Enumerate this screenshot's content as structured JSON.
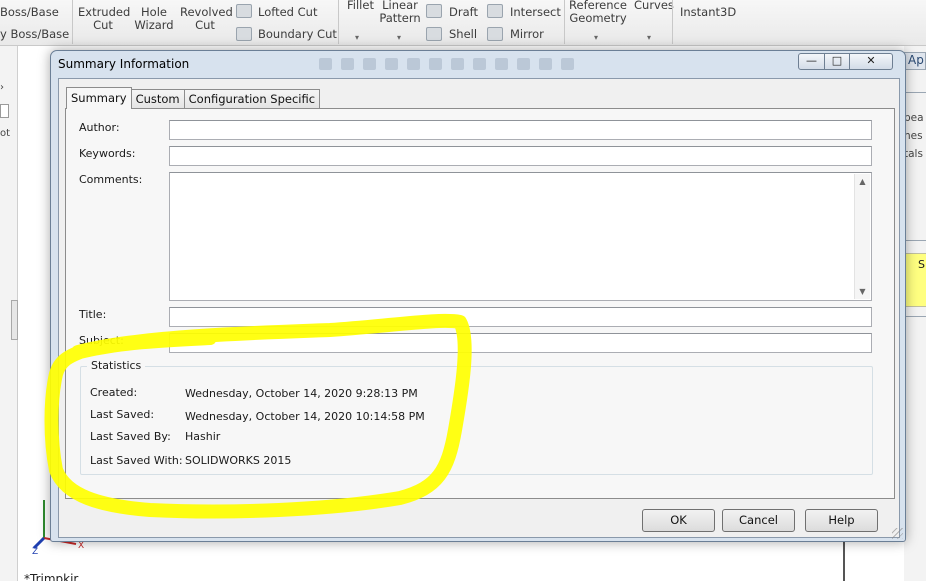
{
  "ribbon": {
    "items": [
      {
        "id": "boss_base",
        "label": "Boss/Base"
      },
      {
        "id": "swept_boss",
        "label": "y Boss/Base"
      },
      {
        "id": "extruded_cut",
        "label": "Extruded Cut"
      },
      {
        "id": "hole_wizard",
        "label": "Hole Wizard"
      },
      {
        "id": "revolved_cut",
        "label": "Revolved Cut"
      },
      {
        "id": "lofted_cut",
        "label": "Lofted Cut"
      },
      {
        "id": "boundary_cut",
        "label": "Boundary Cut"
      },
      {
        "id": "fillet",
        "label": "Fillet"
      },
      {
        "id": "linear_pattern",
        "label": "Linear Pattern"
      },
      {
        "id": "draft",
        "label": "Draft"
      },
      {
        "id": "shell",
        "label": "Shell"
      },
      {
        "id": "intersect",
        "label": "Intersect"
      },
      {
        "id": "mirror",
        "label": "Mirror"
      },
      {
        "id": "reference_geometry",
        "label": "Reference Geometry"
      },
      {
        "id": "curves",
        "label": "Curves"
      },
      {
        "id": "instant3d",
        "label": "Instant3D"
      }
    ]
  },
  "background": {
    "right_panel_tab": "Ap",
    "right_panel_lines": [
      "bea",
      "nes",
      "tals"
    ],
    "right_panel_yellow": "S",
    "left_panel_text": "ot",
    "bottom_text": "*Trimpkir"
  },
  "dialog": {
    "title": "Summary Information",
    "tabs": [
      {
        "label": "Summary",
        "active": true
      },
      {
        "label": "Custom",
        "active": false
      },
      {
        "label": "Configuration Specific",
        "active": false
      }
    ],
    "fields": {
      "author": {
        "label": "Author:",
        "value": ""
      },
      "keywords": {
        "label": "Keywords:",
        "value": ""
      },
      "comments": {
        "label": "Comments:",
        "value": ""
      },
      "title": {
        "label": "Title:",
        "value": ""
      },
      "subject": {
        "label": "Subject:",
        "value": ""
      }
    },
    "statistics": {
      "legend": "Statistics",
      "rows": [
        {
          "label": "Created:",
          "value": "Wednesday, October 14, 2020 9:28:13 PM"
        },
        {
          "label": "Last Saved:",
          "value": "Wednesday, October 14, 2020 10:14:58 PM"
        },
        {
          "label": "Last Saved By:",
          "value": "Hashir"
        },
        {
          "label": "Last Saved With:",
          "value": "SOLIDWORKS 2015"
        }
      ]
    },
    "buttons": {
      "ok": "OK",
      "cancel": "Cancel",
      "help": "Help"
    },
    "window_controls": {
      "minimize": "—",
      "maximize": "□",
      "close": "✕"
    }
  },
  "annotation": {
    "color": "#ffff00",
    "kind": "freehand-circle"
  },
  "colors": {
    "dialog_frame": "#d7e2ee",
    "highlight": "#ffff00",
    "right_yellow": "#ffff80"
  }
}
